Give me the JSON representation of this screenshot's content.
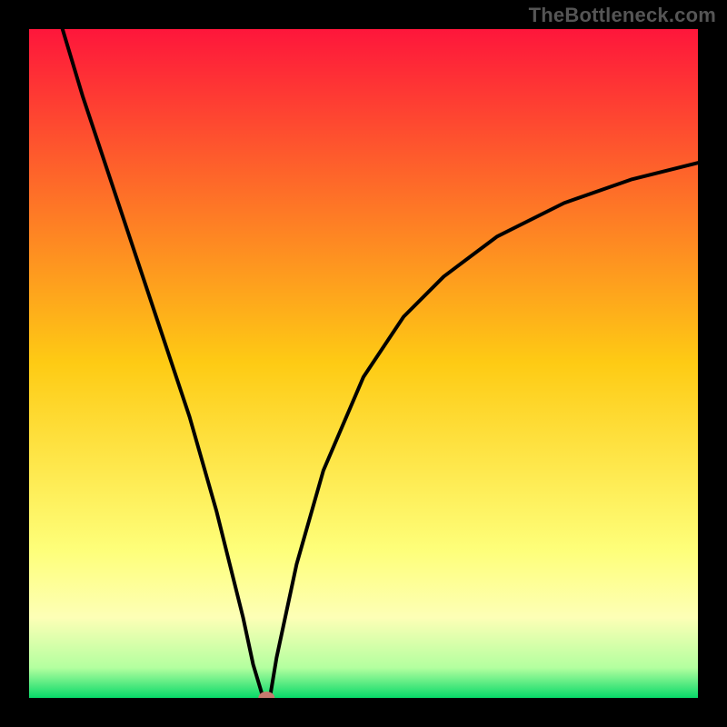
{
  "watermark": "TheBottleneck.com",
  "chart_data": {
    "type": "line",
    "title": "",
    "xlabel": "",
    "ylabel": "",
    "xlim": [
      0,
      100
    ],
    "ylim": [
      0,
      100
    ],
    "grid": false,
    "legend": false,
    "annotations": [],
    "background_gradient": {
      "stops": [
        {
          "offset": 0.0,
          "color": "#fe163b"
        },
        {
          "offset": 0.5,
          "color": "#fecb14"
        },
        {
          "offset": 0.78,
          "color": "#feff7a"
        },
        {
          "offset": 0.88,
          "color": "#fdffb6"
        },
        {
          "offset": 0.955,
          "color": "#b3ff9f"
        },
        {
          "offset": 1.0,
          "color": "#07d968"
        }
      ]
    },
    "curve": {
      "x": [
        5,
        8,
        12,
        16,
        20,
        24,
        28,
        30,
        32,
        33.5,
        35,
        36,
        37,
        40,
        44,
        50,
        56,
        62,
        70,
        80,
        90,
        100
      ],
      "y": [
        100,
        90,
        78,
        66,
        54,
        42,
        28,
        20,
        12,
        5,
        0,
        0,
        6,
        20,
        34,
        48,
        57,
        63,
        69,
        74,
        77.5,
        80
      ]
    },
    "marker": {
      "x": 35.5,
      "y": 0,
      "color": "#c77a6f"
    }
  },
  "colors": {
    "frame": "#000000",
    "curve": "#000000",
    "marker": "#c77a6f",
    "watermark": "#555555"
  }
}
